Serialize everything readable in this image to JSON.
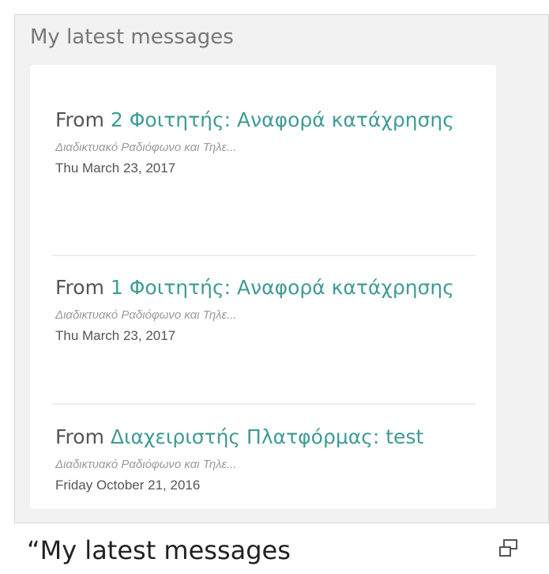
{
  "panel": {
    "title": "My latest messages"
  },
  "messages": [
    {
      "from_label": "From",
      "sender_subject": "2 Φοιτητής: Αναφορά κατάχρησης",
      "course": "Διαδικτυακό Ραδιόφωνο και Τηλε...",
      "date": "Thu March 23, 2017"
    },
    {
      "from_label": "From",
      "sender_subject": "1 Φοιτητής: Αναφορά κατάχρησης",
      "course": "Διαδικτυακό Ραδιόφωνο και Τηλε...",
      "date": "Thu March 23, 2017"
    },
    {
      "from_label": "From",
      "sender_subject": "Διαχειριστής Πλατφόρμας: test",
      "course": "Διαδικτυακό Ραδιόφωνο και Τηλε...",
      "date": "Friday October 21, 2016"
    }
  ],
  "caption": {
    "text": "“My latest messages"
  },
  "icons": {
    "expand": "expand-icon"
  },
  "colors": {
    "link": "#3f9b95",
    "panel_bg": "#f2f2f2"
  }
}
